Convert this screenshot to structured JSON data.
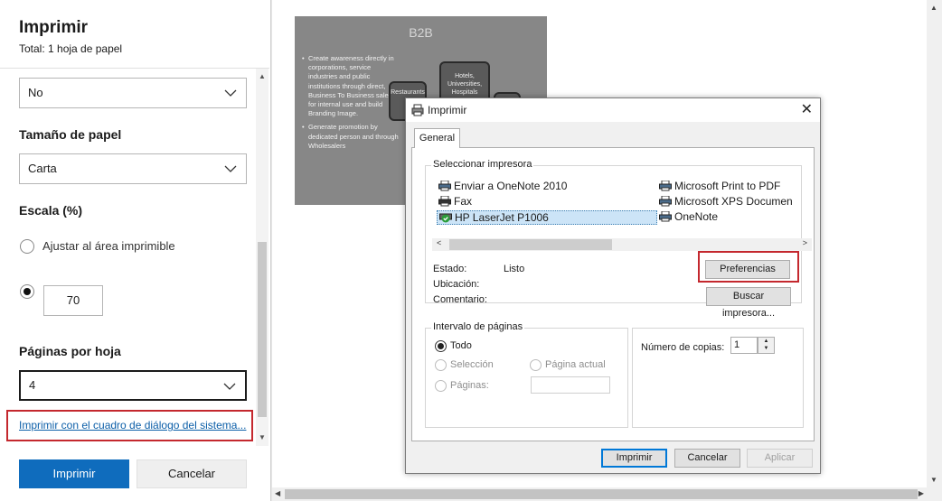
{
  "left_panel": {
    "title": "Imprimir",
    "subtitle": "Total: 1 hoja de papel",
    "select_top_value": "No",
    "paper_size_label": "Tamaño de papel",
    "paper_size_value": "Carta",
    "scale_label": "Escala (%)",
    "fit_option_label": "Ajustar al área imprimible",
    "scale_value": "70",
    "pages_per_sheet_label": "Páginas por hoja",
    "pages_per_sheet_value": "4",
    "system_dialog_link": "Imprimir con el cuadro de diálogo del sistema...",
    "print_button": "Imprimir",
    "cancel_button": "Cancelar"
  },
  "slide": {
    "title": "B2B",
    "bullets": [
      "Create awareness directly in corporations, service industries and public institutions through direct, Business To Business sales for internal use and build Branding Image.",
      "Generate promotion by dedicated person and through Wholesalers"
    ],
    "box_hotels": "Hotels, Universities, Hospitals",
    "box_restaurants": "Restaurants"
  },
  "dialog": {
    "title": "Imprimir",
    "tab_general": "General",
    "select_printer_label": "Seleccionar impresora",
    "printers": [
      "Enviar a OneNote 2010",
      "Fax",
      "HP LaserJet P1006",
      "Microsoft Print to PDF",
      "Microsoft XPS Documen",
      "OneNote"
    ],
    "status_label": "Estado:",
    "status_value": "Listo",
    "location_label": "Ubicación:",
    "comment_label": "Comentario:",
    "preferences_button": "Preferencias",
    "find_printer_button": "Buscar impresora...",
    "page_range_label": "Intervalo de páginas",
    "range_all": "Todo",
    "range_selection": "Selección",
    "range_current": "Página actual",
    "range_pages": "Páginas:",
    "copies_label": "Número de copias:",
    "copies_value": "1",
    "print_button": "Imprimir",
    "cancel_button": "Cancelar",
    "apply_button": "Aplicar"
  },
  "colors": {
    "accent": "#0f6cbd",
    "highlight_box": "#c4282e"
  }
}
